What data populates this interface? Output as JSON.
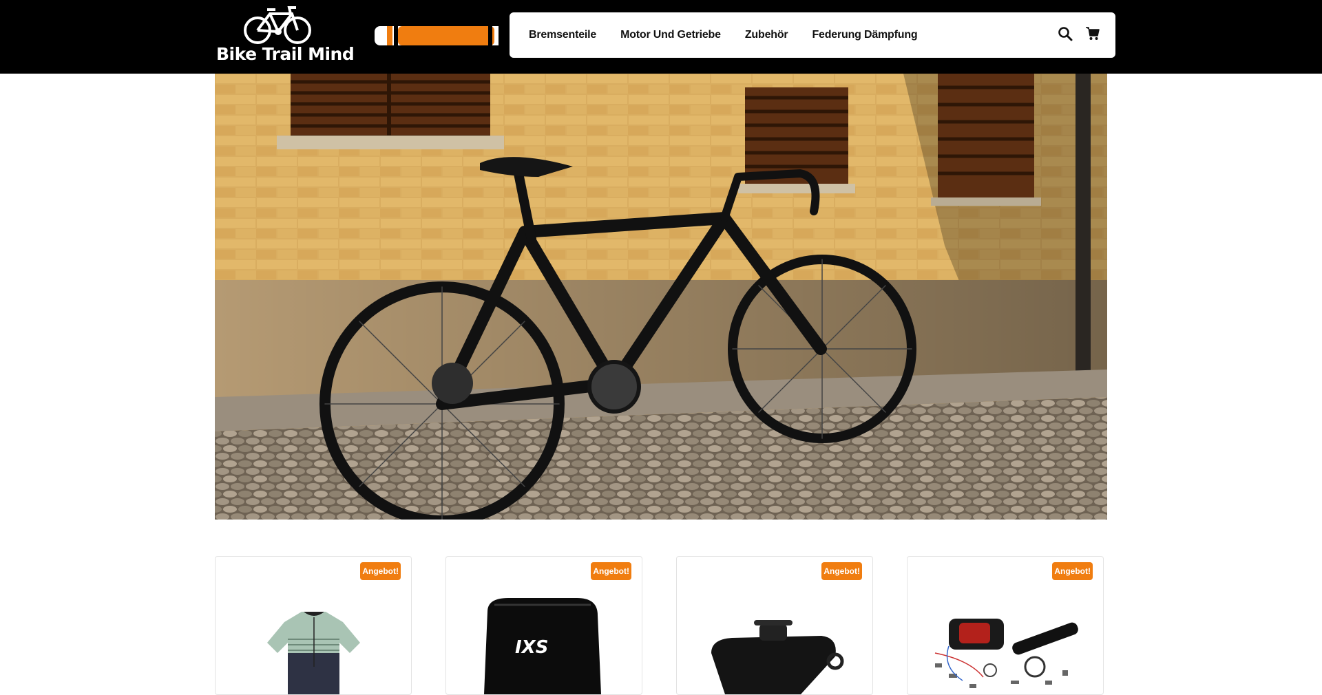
{
  "brand": {
    "name": "Bike Trail Mind",
    "logo_icon": "bicycle-icon"
  },
  "nav": {
    "items": [
      {
        "label": "Bremsenteile"
      },
      {
        "label": "Motor Und Getriebe"
      },
      {
        "label": "Zubehör"
      },
      {
        "label": "Federung Dämpfung"
      }
    ],
    "search_icon": "search-icon",
    "cart_icon": "cart-icon"
  },
  "colors": {
    "accent": "#f07d10",
    "header_bg": "#000000"
  },
  "products": [
    {
      "badge": "Angebot!",
      "image": "jersey"
    },
    {
      "badge": "Angebot!",
      "image": "bike-bag"
    },
    {
      "badge": "Angebot!",
      "image": "saddle-bag"
    },
    {
      "badge": "Angebot!",
      "image": "motor-kit"
    }
  ]
}
